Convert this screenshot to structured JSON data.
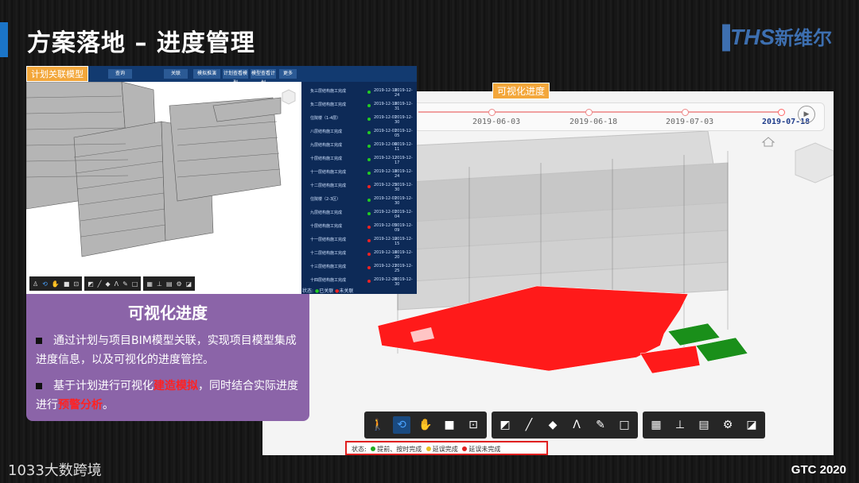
{
  "slide": {
    "title": "方案落地 – 进度管理",
    "logo_latin": "THS",
    "logo_cn": "新维尔",
    "footer_left": "1033大数跨境",
    "footer_right": "GTC 2020"
  },
  "viewer": {
    "tag": "可视化进度",
    "timeline": {
      "dates": [
        "2019-06-03",
        "2019-06-18",
        "2019-07-03",
        "2019-07-18"
      ],
      "active_date": "2019-07-18",
      "play_icon": "play-icon"
    },
    "toolbar_groups": [
      [
        "person-icon",
        "orbit-icon",
        "hand-icon",
        "camera-icon",
        "zoom-box-icon"
      ],
      [
        "box-cut-icon",
        "measure-icon",
        "cube-icon",
        "angle-icon",
        "palette-icon",
        "area-icon"
      ],
      [
        "structure-icon",
        "tree-icon",
        "property-icon",
        "gear-icon",
        "fullscreen-icon"
      ]
    ],
    "legend": {
      "label": "状态:",
      "items": [
        {
          "text": "提前、按时完成",
          "color": "#22aa22"
        },
        {
          "text": "延误完成",
          "color": "#e8c020"
        },
        {
          "text": "延误未完成",
          "color": "#e02020"
        }
      ]
    },
    "colors": {
      "red_floor": "#ff1a1a",
      "green_floor": "#1a8f1a"
    }
  },
  "left_shot": {
    "tag": "计划关联模型",
    "toolbar": [
      "查询",
      "关联",
      "模拟推演",
      "计划查看模型",
      "模型查看计划",
      "更多"
    ],
    "tasks": [
      {
        "name": "负三层结构施工完成",
        "start": "2019-12-18",
        "end": "2019-12-24"
      },
      {
        "name": "负二层结构施工完成",
        "start": "2019-12-18",
        "end": "2019-12-31"
      },
      {
        "name": "住院楼（1-4层）",
        "start": "2019-12-01",
        "end": "2019-12-30"
      },
      {
        "name": "八层结构施工完成",
        "start": "2019-12-01",
        "end": "2019-12-05"
      },
      {
        "name": "九层结构施工完成",
        "start": "2019-12-06",
        "end": "2019-12-11"
      },
      {
        "name": "十层结构施工完成",
        "start": "2019-12-12",
        "end": "2019-12-17"
      },
      {
        "name": "十一层结构施工完成",
        "start": "2019-12-18",
        "end": "2019-12-24"
      },
      {
        "name": "十二层结构施工完成",
        "start": "2019-12-25",
        "end": "2019-12-30"
      },
      {
        "name": "住院楼（2-3区）",
        "start": "2019-12-01",
        "end": "2019-12-30"
      },
      {
        "name": "九层结构施工完成",
        "start": "2019-12-01",
        "end": "2019-12-04"
      },
      {
        "name": "十层结构施工完成",
        "start": "2019-12-05",
        "end": "2019-12-09"
      },
      {
        "name": "十一层结构施工完成",
        "start": "2019-12-10",
        "end": "2019-12-15"
      },
      {
        "name": "十二层结构施工完成",
        "start": "2019-12-16",
        "end": "2019-12-20"
      },
      {
        "name": "十三层结构施工完成",
        "start": "2019-12-21",
        "end": "2019-12-25"
      },
      {
        "name": "十四层结构施工完成",
        "start": "2019-12-26",
        "end": "2019-12-30"
      }
    ],
    "status_label": "状态:",
    "status_items": [
      "已关联",
      "未关联"
    ]
  },
  "panel": {
    "title": "可视化进度",
    "bullet1": "通过计划与项目BIM模型关联，实现项目模型集成进度信息，以及可视化的进度管控。",
    "bullet2_a": "基于计划进行可视化",
    "bullet2_hl1": "建造模拟",
    "bullet2_b": "，同时结合实际进度进行",
    "bullet2_hl2": "预警分析",
    "bullet2_c": "。"
  }
}
